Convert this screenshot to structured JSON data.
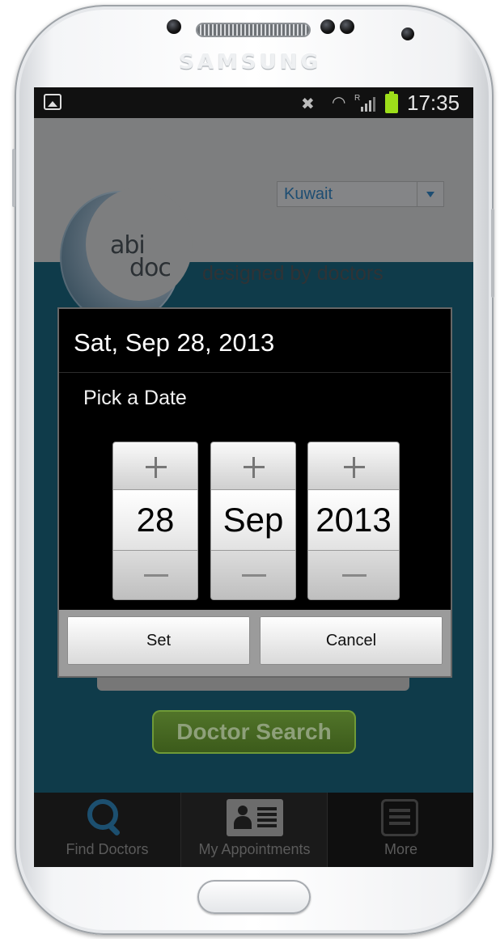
{
  "device": {
    "brand": "SAMSUNG"
  },
  "statusbar": {
    "time": "17:35",
    "roaming_indicator": "R"
  },
  "header": {
    "country_select": {
      "value": "Kuwait"
    },
    "logo": {
      "line1": "abi",
      "line2": "doc"
    },
    "tagline": "designed by doctors"
  },
  "main": {
    "search_button": "Doctor Search"
  },
  "dialog": {
    "title": "Sat, Sep 28, 2013",
    "subtitle": "Pick a Date",
    "day": "28",
    "month": "Sep",
    "year": "2013",
    "set_label": "Set",
    "cancel_label": "Cancel"
  },
  "tabs": [
    {
      "label": "Find Doctors",
      "icon": "search-icon"
    },
    {
      "label": "My Appointments",
      "icon": "contact-card-icon"
    },
    {
      "label": "More",
      "icon": "menu-list-icon"
    }
  ]
}
